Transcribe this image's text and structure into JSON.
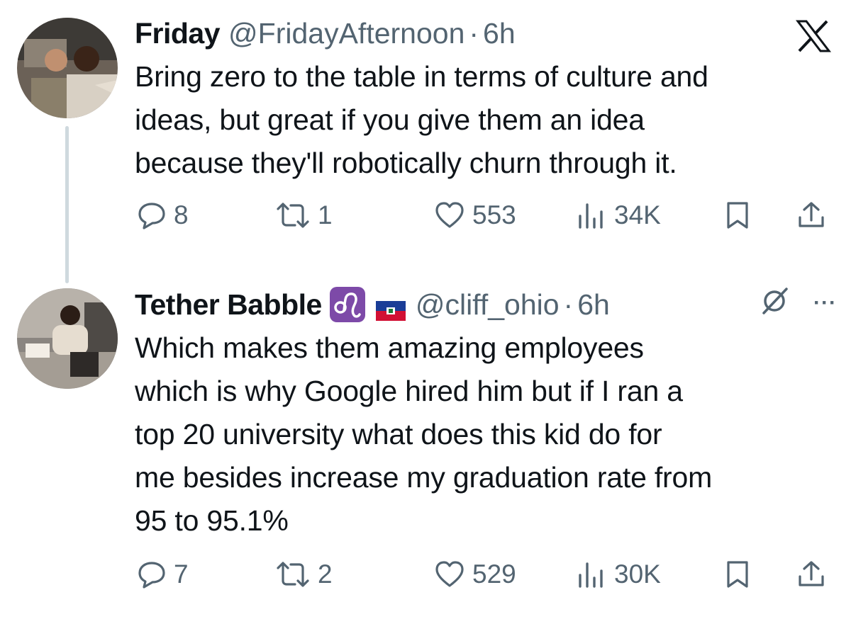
{
  "tweets": [
    {
      "name": "Friday",
      "handle": "@FridayAfternoon",
      "time": "6h",
      "text": "Bring zero to the table in terms of culture and ideas, but great if you give them an idea because they'll robotically  churn through it.",
      "lines": [
        "Bring zero to the table in terms of culture and",
        "ideas, but great if you give them an idea",
        "because they'll robotically  churn through it."
      ],
      "replies": "8",
      "retweets": "1",
      "likes": "553",
      "views": "34K"
    },
    {
      "name": "Tether Babble",
      "handle": "@cliff_ohio",
      "time": "6h",
      "badge_icon": "leo-zodiac-badge",
      "flag_icon": "haiti-flag",
      "lines": [
        "Which makes them amazing employees",
        "which is why Google hired him but if I ran a",
        "top 20 university what does this kid do for",
        "me besides increase my graduation rate from",
        "95 to 95.1%"
      ],
      "replies": "7",
      "retweets": "2",
      "likes": "529",
      "views": "30K"
    }
  ],
  "separator": "·",
  "more_label": "···",
  "colors": {
    "secondary": "#536471",
    "primary": "#0f1419",
    "badge": "#7d4aa8",
    "thread": "#cfd9de"
  }
}
